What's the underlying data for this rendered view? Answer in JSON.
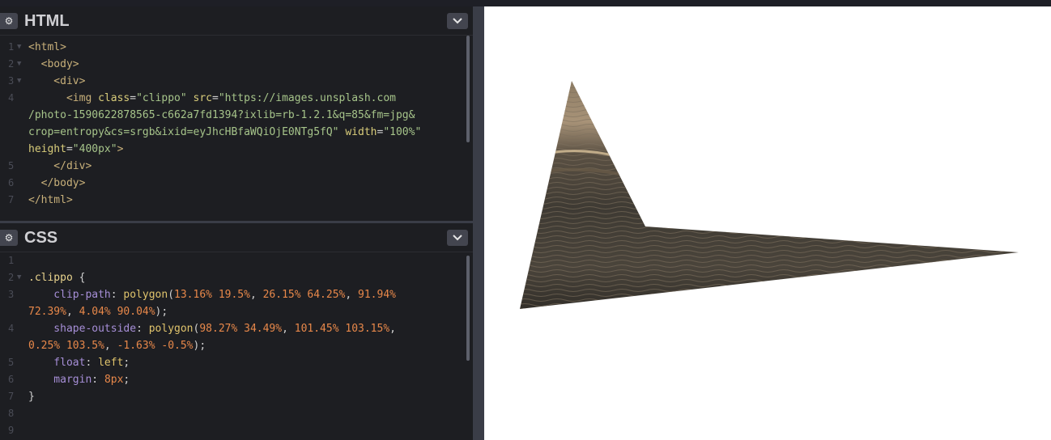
{
  "html_panel": {
    "title": "HTML",
    "gear_icon": "⚙",
    "collapse_icon": "chevron-down",
    "lines": [
      {
        "n": "1",
        "fold": "▼",
        "segments": [
          {
            "c": "t-tag",
            "t": "<html>"
          }
        ]
      },
      {
        "n": "2",
        "fold": "▼",
        "segments": [
          {
            "c": "t-tag",
            "t": "  <body>"
          }
        ]
      },
      {
        "n": "3",
        "fold": "▼",
        "segments": [
          {
            "c": "t-tag",
            "t": "    <div>"
          }
        ]
      },
      {
        "n": "4",
        "fold": "",
        "segments": [
          {
            "c": "t-tag",
            "t": "      <img "
          },
          {
            "c": "t-attr",
            "t": "class"
          },
          {
            "c": "t-punc",
            "t": "="
          },
          {
            "c": "t-str",
            "t": "\"clippo\""
          },
          {
            "c": "t-punc",
            "t": " "
          },
          {
            "c": "t-attr",
            "t": "src"
          },
          {
            "c": "t-punc",
            "t": "="
          },
          {
            "c": "t-str",
            "t": "\"https://images.unsplash.com"
          }
        ]
      },
      {
        "n": "",
        "fold": "",
        "segments": [
          {
            "c": "t-str",
            "t": "/photo-1590622878565-c662a7fd1394?ixlib=rb-1.2.1&q=85&fm=jpg&"
          }
        ]
      },
      {
        "n": "",
        "fold": "",
        "segments": [
          {
            "c": "t-str",
            "t": "crop=entropy&cs=srgb&ixid=eyJhcHBfaWQiOjE0NTg5fQ\""
          },
          {
            "c": "t-punc",
            "t": " "
          },
          {
            "c": "t-attr",
            "t": "width"
          },
          {
            "c": "t-punc",
            "t": "="
          },
          {
            "c": "t-str",
            "t": "\"100%\""
          }
        ]
      },
      {
        "n": "",
        "fold": "",
        "segments": [
          {
            "c": "t-attr",
            "t": "height"
          },
          {
            "c": "t-punc",
            "t": "="
          },
          {
            "c": "t-str",
            "t": "\"400px\""
          },
          {
            "c": "t-tag",
            "t": ">"
          }
        ]
      },
      {
        "n": "5",
        "fold": "",
        "segments": [
          {
            "c": "t-tag",
            "t": "    </div>"
          }
        ]
      },
      {
        "n": "6",
        "fold": "",
        "segments": [
          {
            "c": "t-tag",
            "t": "  </body>"
          }
        ]
      },
      {
        "n": "7",
        "fold": "",
        "segments": [
          {
            "c": "t-tag",
            "t": "</html>"
          }
        ]
      }
    ]
  },
  "css_panel": {
    "title": "CSS",
    "gear_icon": "⚙",
    "collapse_icon": "chevron-down",
    "lines": [
      {
        "n": "1",
        "fold": "",
        "segments": []
      },
      {
        "n": "2",
        "fold": "▼",
        "segments": [
          {
            "c": "t-sel",
            "t": ".clippo"
          },
          {
            "c": "t-punc",
            "t": " {"
          }
        ]
      },
      {
        "n": "3",
        "fold": "",
        "segments": [
          {
            "c": "t-prop",
            "t": "    clip-path"
          },
          {
            "c": "t-punc",
            "t": ": "
          },
          {
            "c": "t-fn",
            "t": "polygon"
          },
          {
            "c": "t-punc",
            "t": "("
          },
          {
            "c": "t-num",
            "t": "13.16% 19.5%"
          },
          {
            "c": "t-punc",
            "t": ", "
          },
          {
            "c": "t-num",
            "t": "26.15% 64.25%"
          },
          {
            "c": "t-punc",
            "t": ", "
          },
          {
            "c": "t-num",
            "t": "91.94%"
          }
        ]
      },
      {
        "n": "",
        "fold": "",
        "segments": [
          {
            "c": "t-num",
            "t": "72.39%"
          },
          {
            "c": "t-punc",
            "t": ", "
          },
          {
            "c": "t-num",
            "t": "4.04% 90.04%"
          },
          {
            "c": "t-punc",
            "t": ");"
          }
        ]
      },
      {
        "n": "4",
        "fold": "",
        "segments": [
          {
            "c": "t-prop",
            "t": "    shape-outside"
          },
          {
            "c": "t-punc",
            "t": ": "
          },
          {
            "c": "t-fn",
            "t": "polygon"
          },
          {
            "c": "t-punc",
            "t": "("
          },
          {
            "c": "t-num",
            "t": "98.27% 34.49%"
          },
          {
            "c": "t-punc",
            "t": ", "
          },
          {
            "c": "t-num",
            "t": "101.45% 103.15%"
          },
          {
            "c": "t-punc",
            "t": ","
          }
        ]
      },
      {
        "n": "",
        "fold": "",
        "segments": [
          {
            "c": "t-num",
            "t": "0.25% 103.5%"
          },
          {
            "c": "t-punc",
            "t": ", "
          },
          {
            "c": "t-num",
            "t": "-1.63% -0.5%"
          },
          {
            "c": "t-punc",
            "t": ");"
          }
        ]
      },
      {
        "n": "5",
        "fold": "",
        "segments": [
          {
            "c": "t-prop",
            "t": "    float"
          },
          {
            "c": "t-punc",
            "t": ": "
          },
          {
            "c": "t-val",
            "t": "left"
          },
          {
            "c": "t-punc",
            "t": ";"
          }
        ]
      },
      {
        "n": "6",
        "fold": "",
        "segments": [
          {
            "c": "t-prop",
            "t": "    margin"
          },
          {
            "c": "t-punc",
            "t": ": "
          },
          {
            "c": "t-num",
            "t": "8px"
          },
          {
            "c": "t-punc",
            "t": ";"
          }
        ]
      },
      {
        "n": "7",
        "fold": "",
        "segments": [
          {
            "c": "t-punc",
            "t": "}"
          }
        ]
      },
      {
        "n": "8",
        "fold": "",
        "segments": []
      },
      {
        "n": "9",
        "fold": "",
        "segments": []
      }
    ]
  },
  "preview": {
    "content": "clipped ocean photo"
  },
  "colors": {
    "editor_bg": "#1d1e22",
    "divider": "#3a3d47",
    "preview_bg": "#ffffff"
  }
}
